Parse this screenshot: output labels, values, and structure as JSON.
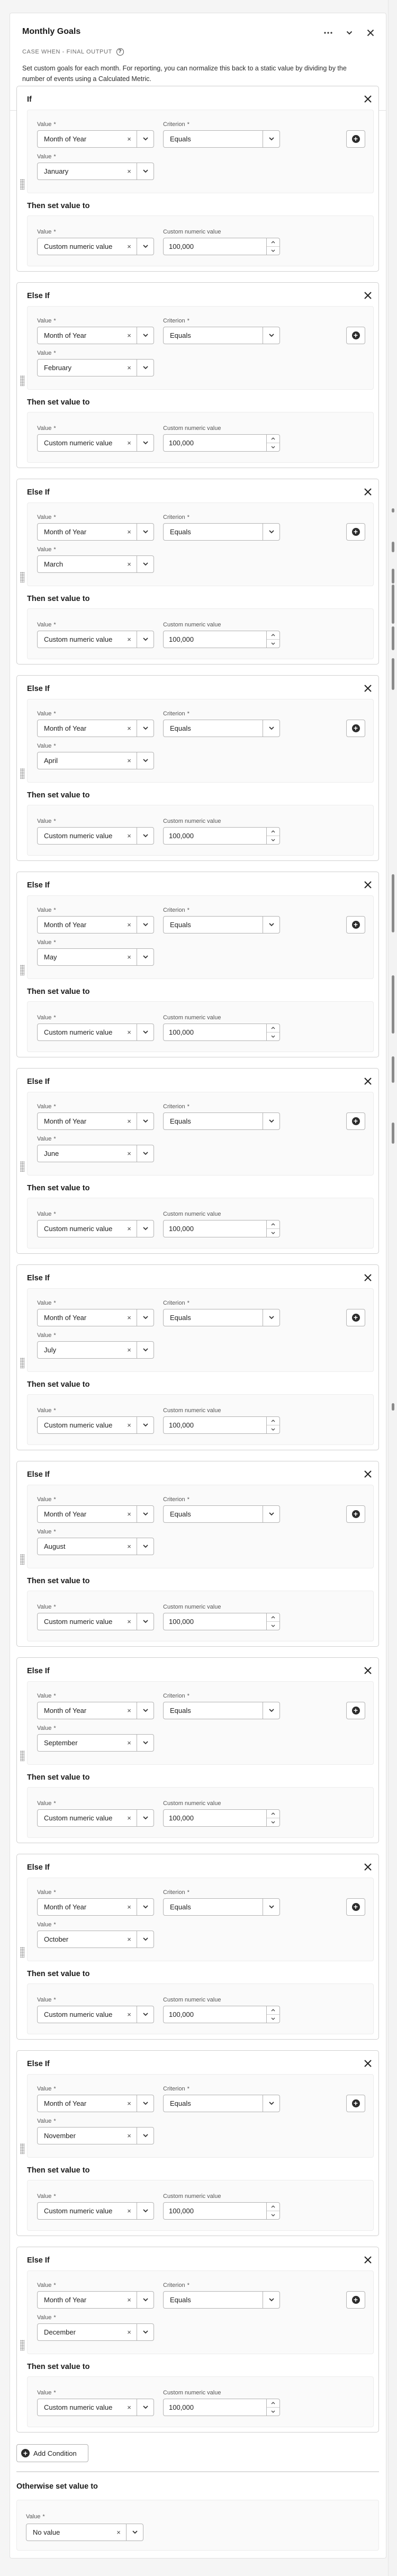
{
  "header": {
    "title": "Monthly Goals",
    "subtitle": "CASE WHEN - FINAL OUTPUT",
    "description": "Set custom goals for each month. For reporting, you can normalize this back to a static value by dividing by the number of events using a Calculated Metric.",
    "help_icon": "?",
    "actions": [
      "more-icon",
      "chevron-down-icon",
      "close-icon"
    ]
  },
  "labels": {
    "value": "Value",
    "required_mark": "*",
    "criterion": "Criterion",
    "custom_numeric_value": "Custom numeric value",
    "then_set_value_to": "Then set value to",
    "clear": "×"
  },
  "conditions": [
    {
      "title": "If",
      "dimension": "Month of Year",
      "criterion": "Equals",
      "match_value": "January",
      "result_type": "Custom numeric value",
      "result_value": "100,000"
    },
    {
      "title": "Else If",
      "dimension": "Month of Year",
      "criterion": "Equals",
      "match_value": "February",
      "result_type": "Custom numeric value",
      "result_value": "100,000"
    },
    {
      "title": "Else If",
      "dimension": "Month of Year",
      "criterion": "Equals",
      "match_value": "March",
      "result_type": "Custom numeric value",
      "result_value": "100,000"
    },
    {
      "title": "Else If",
      "dimension": "Month of Year",
      "criterion": "Equals",
      "match_value": "April",
      "result_type": "Custom numeric value",
      "result_value": "100,000"
    },
    {
      "title": "Else If",
      "dimension": "Month of Year",
      "criterion": "Equals",
      "match_value": "May",
      "result_type": "Custom numeric value",
      "result_value": "100,000"
    },
    {
      "title": "Else If",
      "dimension": "Month of Year",
      "criterion": "Equals",
      "match_value": "June",
      "result_type": "Custom numeric value",
      "result_value": "100,000"
    },
    {
      "title": "Else If",
      "dimension": "Month of Year",
      "criterion": "Equals",
      "match_value": "July",
      "result_type": "Custom numeric value",
      "result_value": "100,000"
    },
    {
      "title": "Else If",
      "dimension": "Month of Year",
      "criterion": "Equals",
      "match_value": "August",
      "result_type": "Custom numeric value",
      "result_value": "100,000"
    },
    {
      "title": "Else If",
      "dimension": "Month of Year",
      "criterion": "Equals",
      "match_value": "September",
      "result_type": "Custom numeric value",
      "result_value": "100,000"
    },
    {
      "title": "Else If",
      "dimension": "Month of Year",
      "criterion": "Equals",
      "match_value": "October",
      "result_type": "Custom numeric value",
      "result_value": "100,000"
    },
    {
      "title": "Else If",
      "dimension": "Month of Year",
      "criterion": "Equals",
      "match_value": "November",
      "result_type": "Custom numeric value",
      "result_value": "100,000"
    },
    {
      "title": "Else If",
      "dimension": "Month of Year",
      "criterion": "Equals",
      "match_value": "December",
      "result_type": "Custom numeric value",
      "result_value": "100,000"
    }
  ],
  "add_condition_label": "Add Condition",
  "otherwise": {
    "title": "Otherwise set value to",
    "value_label": "Value",
    "value": "No value"
  }
}
